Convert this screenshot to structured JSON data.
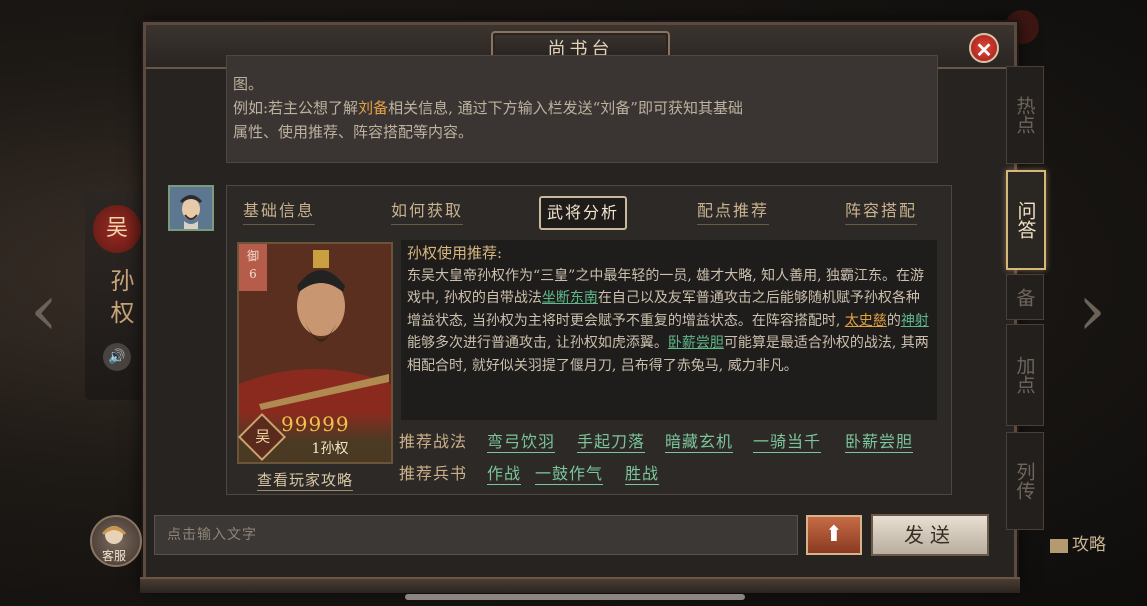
{
  "dialog": {
    "title": "尚书台",
    "close_label": "✕"
  },
  "background": {
    "kingdom_seal": "吴",
    "hero_name": "孙权",
    "strategy_label": "攻略"
  },
  "side_tabs": [
    {
      "label": "热点",
      "active": false
    },
    {
      "label": "问答",
      "active": true
    },
    {
      "label": "备",
      "active": false
    },
    {
      "label": "加点",
      "active": false
    },
    {
      "label": "列传",
      "active": false
    }
  ],
  "intro": {
    "line0": "",
    "line1": "图。",
    "line2_prefix": "例如:若主公想了解",
    "line2_highlight": "刘备",
    "line2_suffix": "相关信息, 通过下方输入栏发送“刘备”即可获知其基础",
    "line3": "属性、使用推荐、阵容搭配等内容。"
  },
  "tabs": [
    {
      "label": "基础信息",
      "active": false
    },
    {
      "label": "如何获取",
      "active": false
    },
    {
      "label": "武将分析",
      "active": true
    },
    {
      "label": "配点推荐",
      "active": false
    },
    {
      "label": "阵容搭配",
      "active": false
    }
  ],
  "hero_card": {
    "badge_top": "御",
    "badge_num": "6",
    "kingdom": "吴",
    "stars": "99999",
    "name": "1孙权"
  },
  "guide_link": "查看玩家攻略",
  "analysis": {
    "heading": "孙权使用推荐:",
    "p1": "东吴大皇帝孙权作为“三皇”之中最年轻的一员, 雄才大略, 知人善用, 独霸江东。在游戏中, 孙权的自带战法",
    "link1": "坐断东南",
    "p2": "在自己以及友军普通攻击之后能够随机赋予孙权各种增益状态, 当孙权为主将时更会赋予不重复的增益状态。在阵容搭配时, ",
    "link2": "太史慈",
    "p3": "的",
    "link3": "神射",
    "p4": "能够多次进行普通攻击, 让孙权如虎添翼。",
    "link4": "卧薪尝胆",
    "p5": "可能算是最适合孙权的战法, 其两相配合时, 就好似关羽提了偃月刀, 吕布得了赤兔马, 威力非凡。"
  },
  "recommend_tactics": {
    "label": "推荐战法",
    "items": [
      "弯弓饮羽",
      "手起刀落",
      "暗藏玄机",
      "一骑当千",
      "卧薪尝胆"
    ]
  },
  "recommend_books": {
    "label": "推荐兵书",
    "items": [
      "作战",
      "一鼓作气",
      "胜战"
    ]
  },
  "input": {
    "placeholder": "点击输入文字",
    "send_label": "发送",
    "up_label": "⬆",
    "customer_service": "客服"
  },
  "colors": {
    "accent_gold": "#d7b67a",
    "link_green": "#7cc59a",
    "highlight_orange": "#e5a04a",
    "close_red": "#c9332a"
  }
}
